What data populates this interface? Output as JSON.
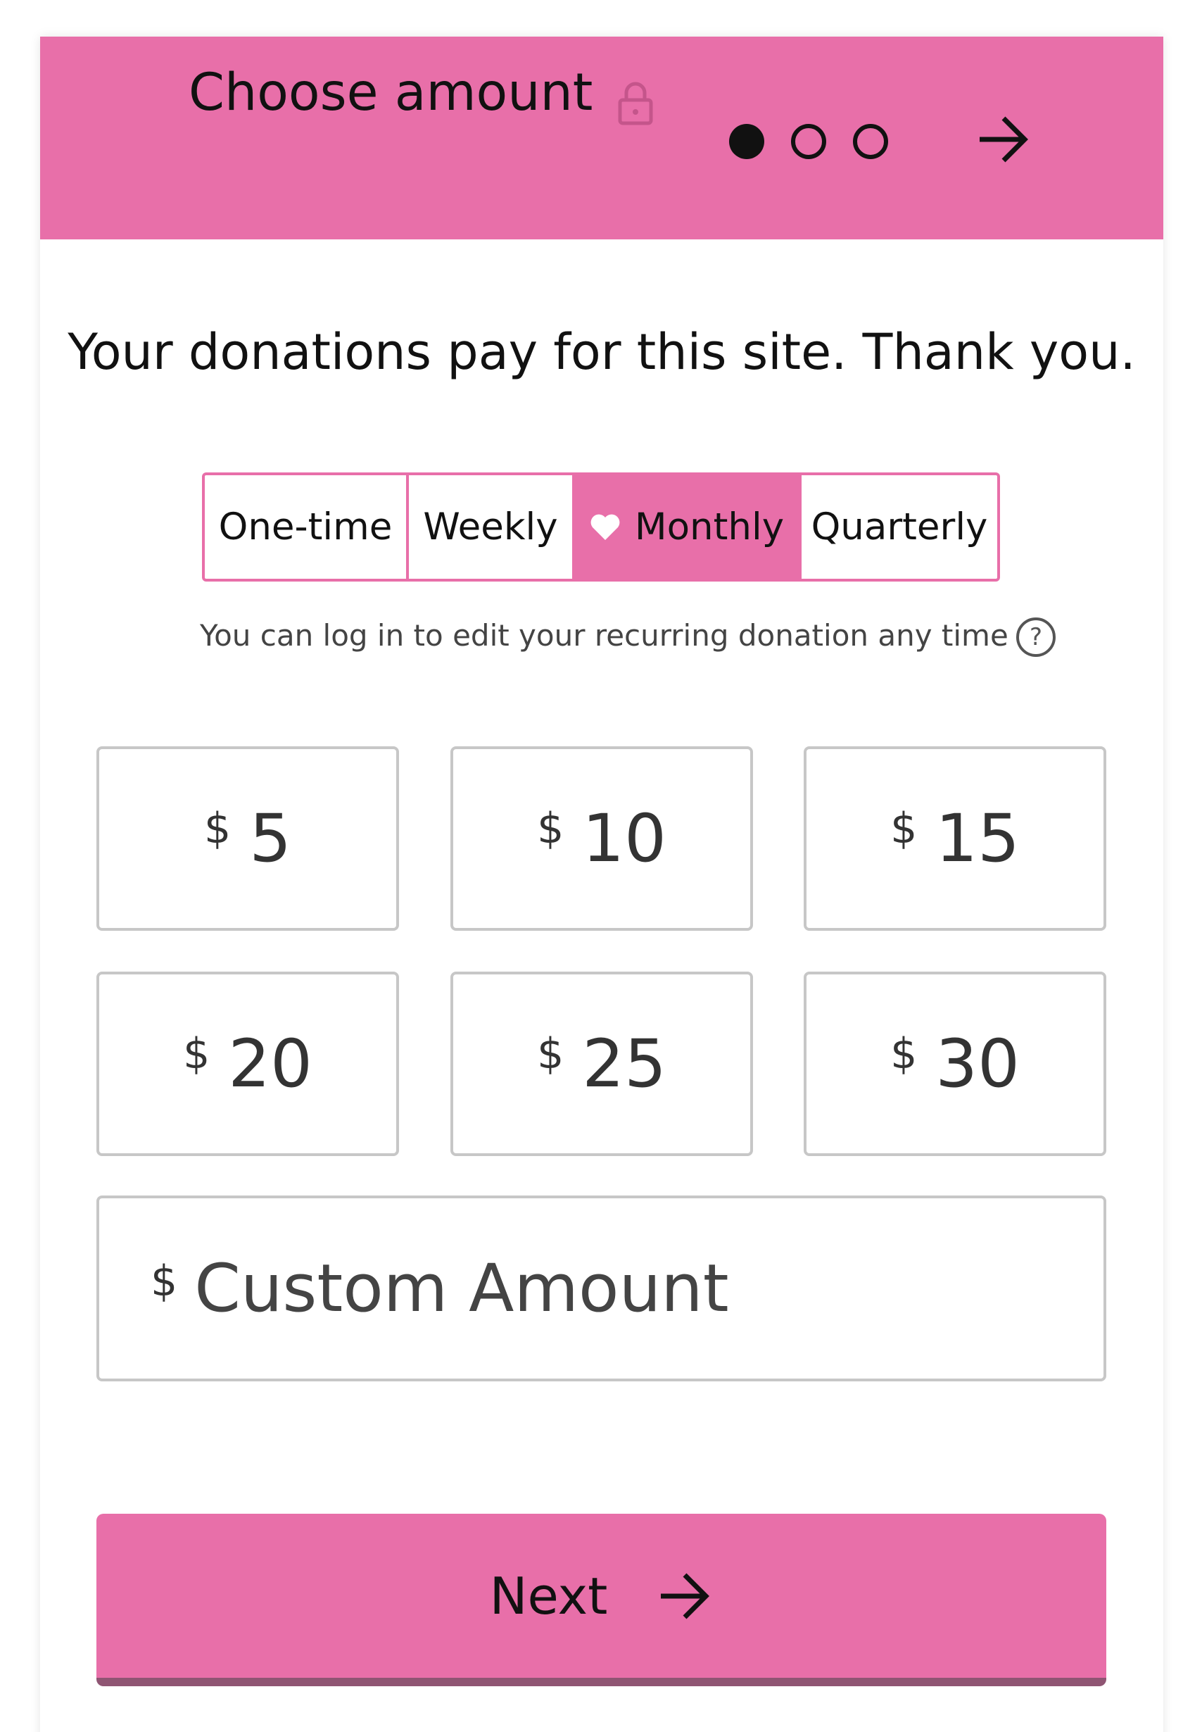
{
  "header": {
    "title": "Choose amount",
    "lock_icon": "lock-icon",
    "steps": [
      "active",
      "inactive",
      "inactive"
    ],
    "next_icon": "arrow-right-icon"
  },
  "intro": "Your donations pay for this site. Thank you.",
  "frequency": {
    "options": [
      "One-time",
      "Weekly",
      "Monthly",
      "Quarterly"
    ],
    "selected": "Monthly",
    "selected_icon": "heart-icon"
  },
  "note": "You can log in to edit your recurring donation any time",
  "help": {
    "glyph": "?"
  },
  "amounts": [
    {
      "currency": "$",
      "value": "5"
    },
    {
      "currency": "$",
      "value": "10"
    },
    {
      "currency": "$",
      "value": "15"
    },
    {
      "currency": "$",
      "value": "20"
    },
    {
      "currency": "$",
      "value": "25"
    },
    {
      "currency": "$",
      "value": "30"
    }
  ],
  "custom": {
    "currency": "$",
    "placeholder": "Custom Amount"
  },
  "next_button": {
    "label": "Next"
  },
  "colors": {
    "accent": "#e86fa9",
    "accent_shadow": "#8f5573",
    "border": "#c7c7c7",
    "text": "#111111"
  }
}
